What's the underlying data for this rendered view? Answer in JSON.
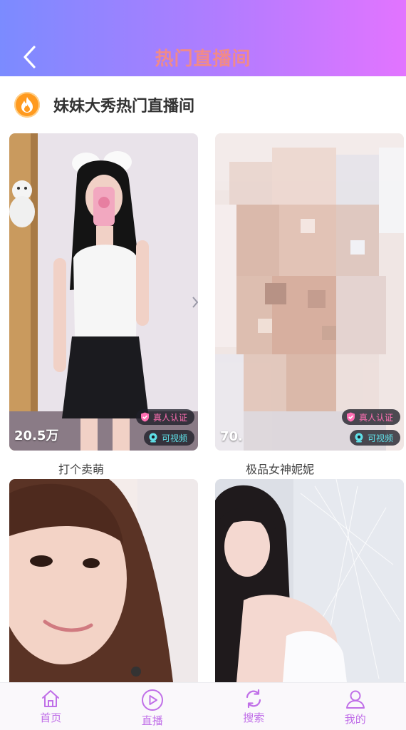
{
  "header": {
    "title": "热门直播间"
  },
  "section": {
    "title": "妹妹大秀热门直播间"
  },
  "cards": [
    {
      "viewers": "20.5万",
      "name": "打个卖萌",
      "verified": "真人认证",
      "video": "可视频"
    },
    {
      "viewers": "70.",
      "name": "极品女神妮妮",
      "verified": "真人认证",
      "video": "可视频"
    },
    {
      "viewers": "",
      "name": ""
    },
    {
      "viewers": "",
      "name": ""
    }
  ],
  "nav": [
    {
      "label": "首页",
      "icon": "home-icon"
    },
    {
      "label": "直播",
      "icon": "play-icon"
    },
    {
      "label": "搜索",
      "icon": "refresh-icon"
    },
    {
      "label": "我的",
      "icon": "user-icon"
    }
  ],
  "colors": {
    "header_gradient_start": "#7b8bff",
    "header_gradient_end": "#e274ff",
    "header_title": "#f08a8a",
    "nav_accent": "#c06fe8",
    "verified_tag": "#ff6fb3",
    "video_tag": "#5fe0e8"
  }
}
